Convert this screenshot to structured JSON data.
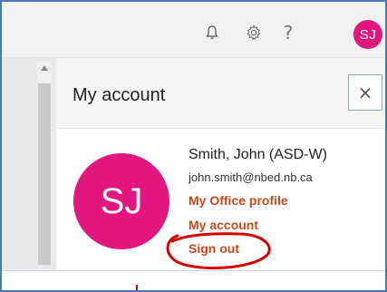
{
  "topbar": {
    "icons": {
      "notifications": "bell-icon",
      "settings": "gear-icon",
      "help": "help-icon"
    },
    "help_glyph": "?",
    "avatar_initials": "SJ"
  },
  "panel": {
    "title": "My account",
    "close_glyph": "×"
  },
  "user": {
    "initials": "SJ",
    "name": "Smith, John (ASD-W)",
    "email": "john.smith@nbed.nb.ca"
  },
  "links": {
    "office_profile": "My Office profile",
    "my_account": "My account",
    "sign_out": "Sign out"
  },
  "colors": {
    "avatar": "#e3157f",
    "link": "#c74a1b",
    "annotation": "#d40000"
  }
}
